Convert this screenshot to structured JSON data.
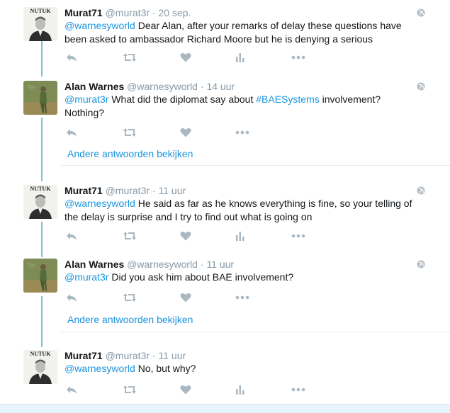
{
  "tweets": [
    {
      "name": "Murat71",
      "handle": "@murat3r",
      "separator": "·",
      "time": "20 sep.",
      "avatar_label": "NUTUK",
      "avatar_type": "murat",
      "text_link": "@warnesyworld",
      "text": " Dear Alan, after your remarks of delay these questions have been asked to ambassador Richard Moore but he is denying a serious",
      "has_analytics": true
    },
    {
      "name": "Alan Warnes",
      "handle": "@warnesyworld",
      "separator": "·",
      "time": "14 uur",
      "avatar_type": "alan",
      "text_link": "@murat3r",
      "text_mid": " What did the diplomat say about ",
      "text_hashtag": "#BAESystems",
      "text_end": " involvement? Nothing?",
      "has_analytics": false,
      "more_replies": "Andere antwoorden bekijken"
    },
    {
      "name": "Murat71",
      "handle": "@murat3r",
      "separator": "·",
      "time": "11 uur",
      "avatar_label": "NUTUK",
      "avatar_type": "murat",
      "text_link": "@warnesyworld",
      "text": " He said as far as he knows everything is fine, so your telling of the delay is surprise and I try to find out what is going on",
      "has_analytics": true
    },
    {
      "name": "Alan Warnes",
      "handle": "@warnesyworld",
      "separator": "·",
      "time": "11 uur",
      "avatar_type": "alan",
      "text_link": "@murat3r",
      "text": " Did you ask him about BAE involvement?",
      "has_analytics": false,
      "more_replies": "Andere antwoorden bekijken"
    },
    {
      "name": "Murat71",
      "handle": "@murat3r",
      "separator": "·",
      "time": "11 uur",
      "avatar_label": "NUTUK",
      "avatar_type": "murat",
      "text_link": "@warnesyworld",
      "text": " No, but why?",
      "has_analytics": true
    }
  ],
  "icons": {
    "reply": "reply-icon",
    "retweet": "retweet-icon",
    "like": "heart-icon",
    "analytics": "bar-chart-icon",
    "more": "more-dots-icon",
    "globe": "globe-icon"
  },
  "colors": {
    "link": "#1b95e0",
    "icon": "#aab8c2",
    "thread_line": "#7fc0d9",
    "muted_text": "#8899a6"
  }
}
